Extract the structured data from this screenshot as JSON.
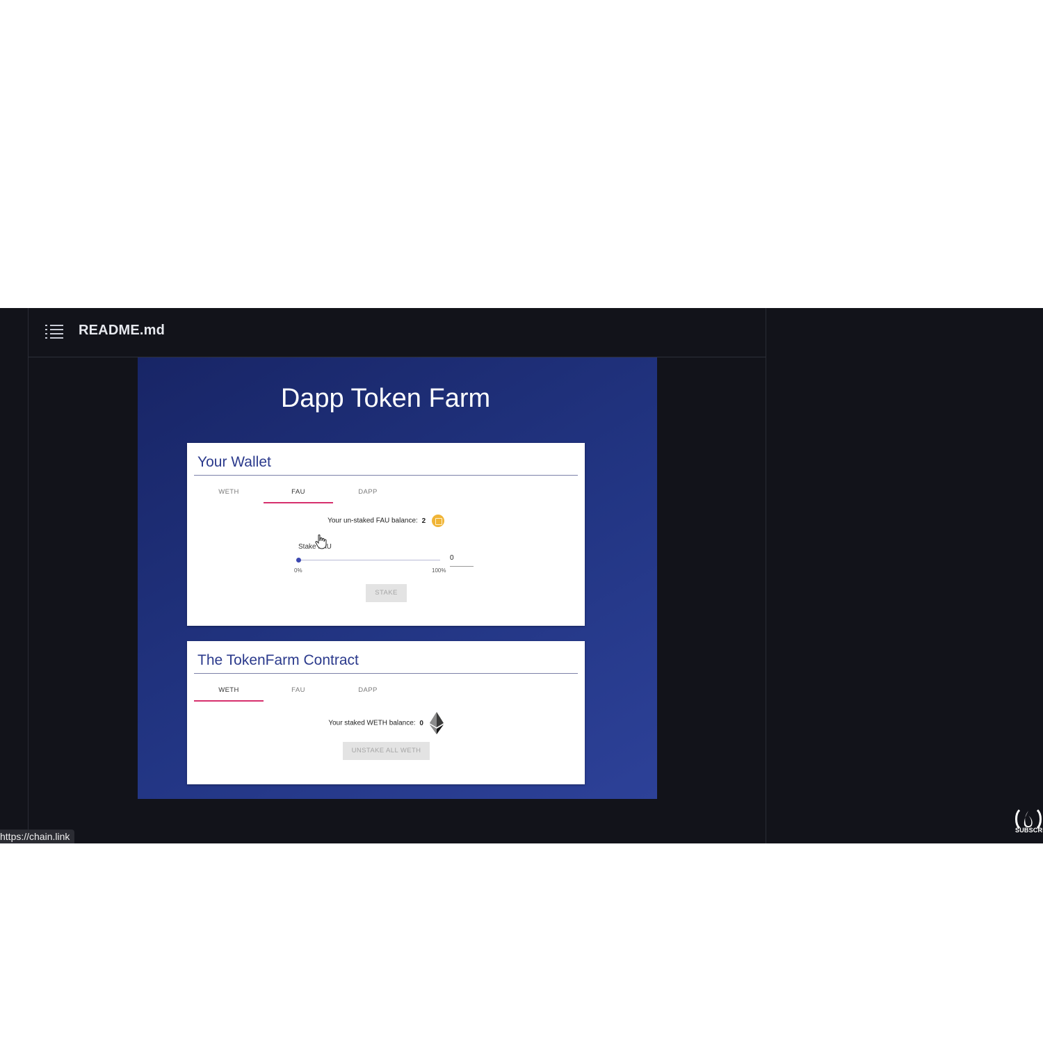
{
  "readme": {
    "title": "README.md",
    "menu_icon": "list-icon"
  },
  "dapp": {
    "title": "Dapp Token Farm",
    "wallet_card": {
      "title": "Your Wallet",
      "tabs": [
        {
          "label": "WETH",
          "active": false
        },
        {
          "label": "FAU",
          "active": true
        },
        {
          "label": "DAPP",
          "active": false
        }
      ],
      "balance_label": "Your un-staked FAU balance:",
      "balance_value": "2",
      "token_icon": "fau-coin-icon",
      "stake_label": "Stake FAU",
      "slider": {
        "min_label": "0%",
        "max_label": "100%",
        "value_percent": 0
      },
      "amount_value": "0",
      "stake_button": "STAKE"
    },
    "contract_card": {
      "title": "The TokenFarm Contract",
      "tabs": [
        {
          "label": "WETH",
          "active": true
        },
        {
          "label": "FAU",
          "active": false
        },
        {
          "label": "DAPP",
          "active": false
        }
      ],
      "balance_label": "Your staked WETH balance:",
      "balance_value": "0",
      "token_icon": "ethereum-icon",
      "unstake_button": "UNSTAKE ALL WETH"
    }
  },
  "status_bar": {
    "url": "https://chain.link"
  },
  "channel_badge": {
    "subscribe_text": "SUBSCRIBE",
    "icon": "freecodecamp-icon"
  },
  "colors": {
    "accent_tab": "#d62f6c",
    "card_title": "#2b3a8c",
    "fau_coin": "#f0b436"
  }
}
